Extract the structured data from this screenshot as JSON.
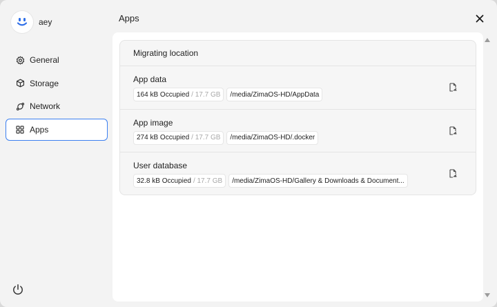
{
  "profile": {
    "username": "aey",
    "avatar_icon": "smiley-face-icon",
    "accent": "#2f6fe8"
  },
  "sidebar": {
    "items": [
      {
        "label": "General",
        "icon": "gear-icon",
        "active": false
      },
      {
        "label": "Storage",
        "icon": "cube-icon",
        "active": false
      },
      {
        "label": "Network",
        "icon": "network-icon",
        "active": false
      },
      {
        "label": "Apps",
        "icon": "grid-icon",
        "active": true
      }
    ],
    "power_icon": "power-icon"
  },
  "header": {
    "title": "Apps",
    "close_icon": "close-icon"
  },
  "card": {
    "title": "Migrating location",
    "rows": [
      {
        "title": "App data",
        "occupied": "164 kB Occupied",
        "total": "/ 17.7 GB",
        "path": "/media/ZimaOS-HD/AppData",
        "action_icon": "file-edit-icon"
      },
      {
        "title": "App image",
        "occupied": "274 kB Occupied",
        "total": "/ 17.7 GB",
        "path": "/media/ZimaOS-HD/.docker",
        "action_icon": "file-edit-icon"
      },
      {
        "title": "User database",
        "occupied": "32.8 kB Occupied",
        "total": "/ 17.7 GB",
        "path": "/media/ZimaOS-HD/Gallery & Downloads & Document...",
        "action_icon": "file-edit-icon"
      }
    ]
  },
  "colors": {
    "active_border": "#3b7ff0",
    "muted_text": "#a8a8a8",
    "background": "#f3f3f3"
  }
}
